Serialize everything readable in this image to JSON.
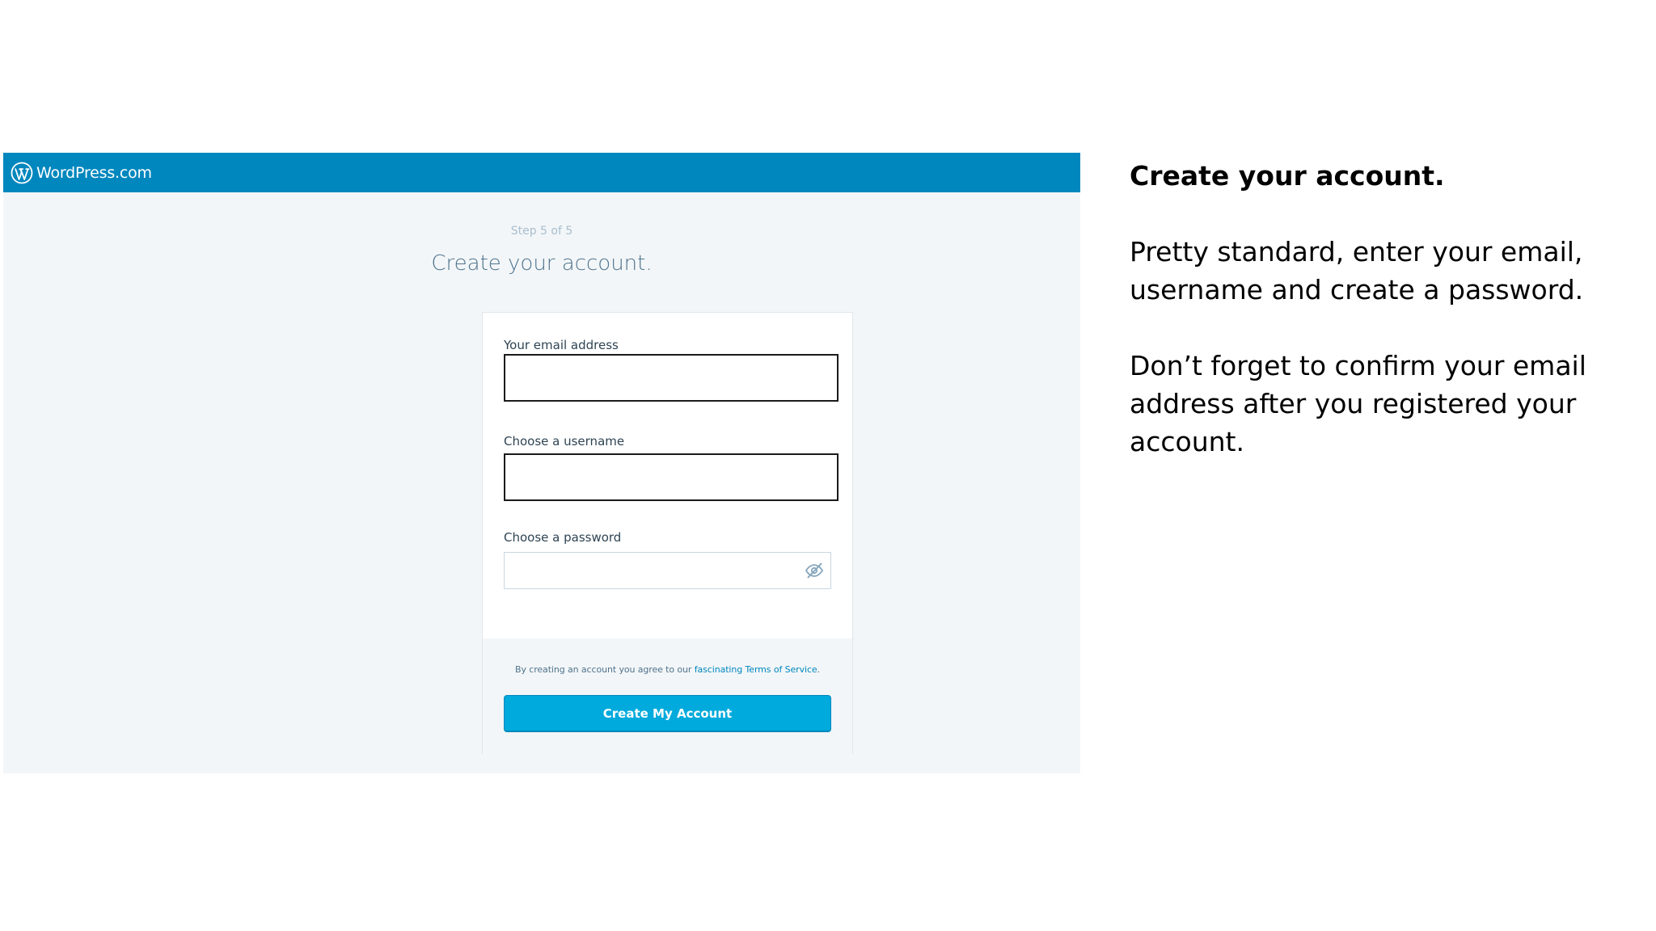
{
  "screenshot": {
    "brand": {
      "name": "WordPress.com",
      "logo_icon": "wordpress-logo-icon"
    },
    "step_text": "Step 5 of 5",
    "headline": "Create your account.",
    "form": {
      "email_label": "Your email address",
      "email_value": "",
      "username_label": "Choose a username",
      "username_value": "",
      "password_label": "Choose a password",
      "password_value": "",
      "password_toggle_icon": "eye-slash-icon"
    },
    "footer": {
      "tos_prefix": "By creating an account you agree to our ",
      "tos_link": "fascinating Terms of Service",
      "tos_suffix": ".",
      "submit_label": "Create My Account"
    },
    "colors": {
      "masterbar": "#0087be",
      "button": "#00aadc",
      "background": "#f3f6f8"
    }
  },
  "notes": {
    "title": "Create your account.",
    "paragraph_1": "Pretty standard, enter your email, username and create a password.",
    "paragraph_2": "Don’t forget to confirm your email address after you registered your account."
  }
}
